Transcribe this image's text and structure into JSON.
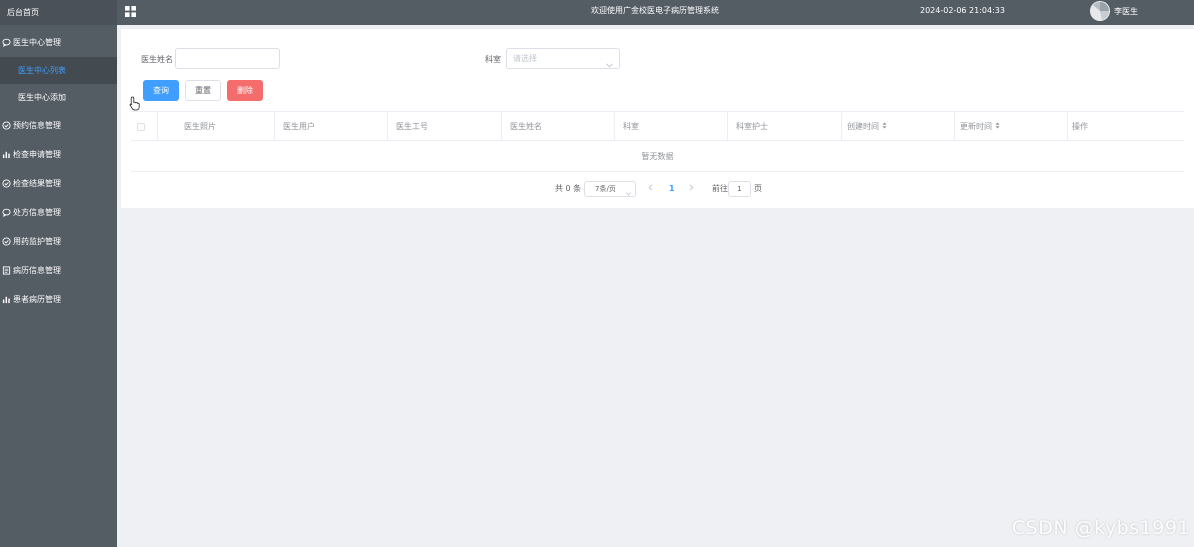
{
  "sidebar": {
    "brand": "后台首页",
    "items": [
      {
        "label": "医生中心管理",
        "icon": "chat-icon"
      },
      {
        "label": "医生中心列表",
        "submenu": true,
        "active": true
      },
      {
        "label": "医生中心添加",
        "submenu": true
      },
      {
        "label": "预约信息管理",
        "icon": "check-circle-icon"
      },
      {
        "label": "检查申请管理",
        "icon": "bar-chart-icon"
      },
      {
        "label": "检查结果管理",
        "icon": "check-circle-icon"
      },
      {
        "label": "处方信息管理",
        "icon": "chat-icon"
      },
      {
        "label": "用药监护管理",
        "icon": "check-circle-icon"
      },
      {
        "label": "病历信息管理",
        "icon": "document-icon"
      },
      {
        "label": "患者病历管理",
        "icon": "bar-chart-icon"
      }
    ]
  },
  "header": {
    "title": "欢迎使用广金校医电子病历管理系统",
    "datetime": "2024-02-06 21:04:33",
    "username": "李医生"
  },
  "search": {
    "name_label": "医生姓名",
    "name_value": "",
    "dept_label": "科室",
    "dept_placeholder": "请选择"
  },
  "buttons": {
    "query": "查询",
    "reset": "重置",
    "delete": "删除"
  },
  "table": {
    "columns": [
      "医生照片",
      "医生用户",
      "医生工号",
      "医生姓名",
      "科室",
      "科室护士",
      "创建时间",
      "更新时间",
      "操作"
    ],
    "sortable": [
      false,
      false,
      false,
      false,
      false,
      false,
      true,
      true,
      false
    ],
    "empty_text": "暂无数据"
  },
  "pagination": {
    "total": "共 0 条",
    "page_size": "7条/页",
    "current_page": "1",
    "goto_label": "前往",
    "goto_value": "1",
    "page_suffix": "页"
  },
  "watermark": "CSDN @kybs1991",
  "colors": {
    "sidebar_bg": "#545c64",
    "primary": "#409eff",
    "danger": "#f56c6c"
  }
}
